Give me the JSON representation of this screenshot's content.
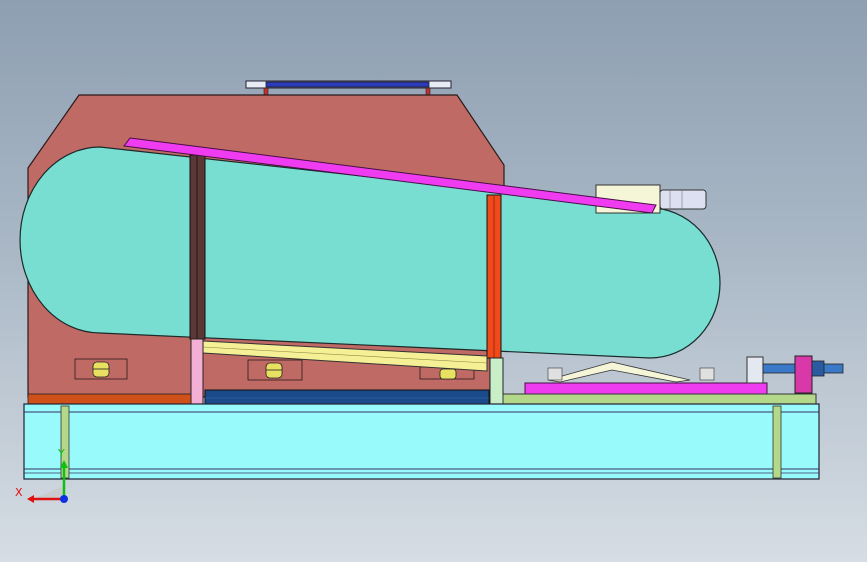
{
  "viewport": {
    "background_top": "#8e9fb2",
    "background_bottom": "#d6dde4"
  },
  "axis_triad": {
    "x_label": "X",
    "y_label": "Y",
    "x_color": "#e01010",
    "y_color": "#10c010",
    "z_color": "#1030e0"
  },
  "colors": {
    "housing": "#c06a66",
    "belt": "#78ded2",
    "base": "#98fafa",
    "tension_arm": "#f03cf0",
    "post_left": "#5a3836",
    "post_right": "#f04a1a",
    "motor_mount": "#f5f5d8",
    "motor_shaft": "#dde0f0",
    "platform": "#f03cf0",
    "plate_green": "#b4d88a",
    "yellow_rail": "#f5f096",
    "bottom_rail": "#1a4a8a",
    "screw_blue": "#3a78c8",
    "guard_blue": "#2a3ab8",
    "pink_post": "#f4b0d4"
  }
}
